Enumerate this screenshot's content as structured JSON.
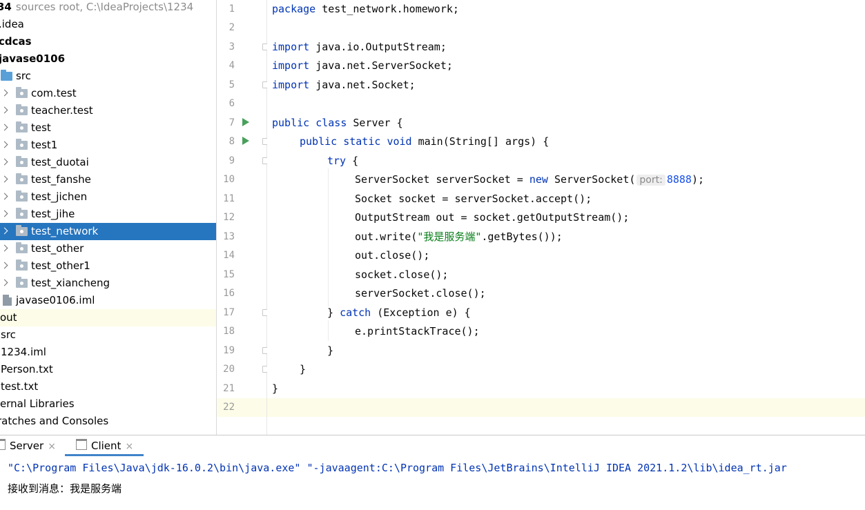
{
  "project_tree": {
    "items": [
      {
        "label": "34",
        "hint": "sources root,  C:\\IdeaProjects\\1234",
        "bold": true
      },
      {
        "label": ".idea"
      },
      {
        "label": "cdcas",
        "bold": true
      },
      {
        "label": "javase0106",
        "bold": true
      },
      {
        "label": "src"
      },
      {
        "label": "com.test"
      },
      {
        "label": "teacher.test"
      },
      {
        "label": "test"
      },
      {
        "label": "test1"
      },
      {
        "label": "test_duotai"
      },
      {
        "label": "test_fanshe"
      },
      {
        "label": "test_jichen"
      },
      {
        "label": "test_jihe"
      },
      {
        "label": "test_network",
        "selected": true
      },
      {
        "label": "test_other"
      },
      {
        "label": "test_other1"
      },
      {
        "label": "test_xiancheng"
      },
      {
        "label": "javase0106.iml"
      },
      {
        "label": "out"
      },
      {
        "label": "src"
      },
      {
        "label": "1234.iml"
      },
      {
        "label": "Person.txt"
      },
      {
        "label": "test.txt"
      },
      {
        "label": "ernal Libraries"
      },
      {
        "label": "ratches and Consoles"
      }
    ]
  },
  "editor": {
    "line_numbers": [
      "1",
      "2",
      "3",
      "4",
      "5",
      "6",
      "7",
      "8",
      "9",
      "10",
      "11",
      "12",
      "13",
      "14",
      "15",
      "16",
      "17",
      "18",
      "19",
      "20",
      "21",
      "22"
    ],
    "code": {
      "l1_kw": "package",
      "l1_rest": " test_network.homework;",
      "l3_kw": "import",
      "l3_rest": " java.io.OutputStream;",
      "l4_kw": "import",
      "l4_rest": " java.net.ServerSocket;",
      "l5_kw": "import",
      "l5_rest": " java.net.Socket;",
      "l7_kw1": "public",
      "l7_kw2": "class",
      "l7_rest": " Server {",
      "l8_kw1": "public",
      "l8_kw2": "static",
      "l8_kw3": "void",
      "l8_rest": " main(String[] args) {",
      "l9_kw": "try",
      "l9_rest": " {",
      "l10_a": "ServerSocket serverSocket = ",
      "l10_kw": "new",
      "l10_b": " ServerSocket(",
      "l10_hint": "port:",
      "l10_num": "8888",
      "l10_c": ");",
      "l11": "Socket socket = serverSocket.accept();",
      "l12": "OutputStream out = socket.getOutputStream();",
      "l13_a": "out.write(",
      "l13_str": "\"我是服务端\"",
      "l13_b": ".getBytes());",
      "l14": "out.close();",
      "l15": "socket.close();",
      "l16": "serverSocket.close();",
      "l17_a": "} ",
      "l17_kw": "catch",
      "l17_b": " (Exception e) {",
      "l18": "e.printStackTrace();",
      "l19": "}",
      "l20": "}",
      "l21": "}"
    }
  },
  "run_panel": {
    "tabs": [
      {
        "label": "Server",
        "close": "×"
      },
      {
        "label": "Client",
        "close": "×",
        "active": true
      }
    ],
    "console": [
      "\"C:\\Program Files\\Java\\jdk-16.0.2\\bin\\java.exe\" \"-javaagent:C:\\Program Files\\JetBrains\\IntelliJ IDEA 2021.1.2\\lib\\idea_rt.jar",
      "接收到消息：我是服务端"
    ]
  },
  "colors": {
    "keyword": "#0033b3",
    "string": "#067d17",
    "number": "#1750eb",
    "selection": "#2675bf",
    "current_line": "#fcfce8",
    "run_icon": "#49a05b",
    "console_command": "#0033b3"
  }
}
